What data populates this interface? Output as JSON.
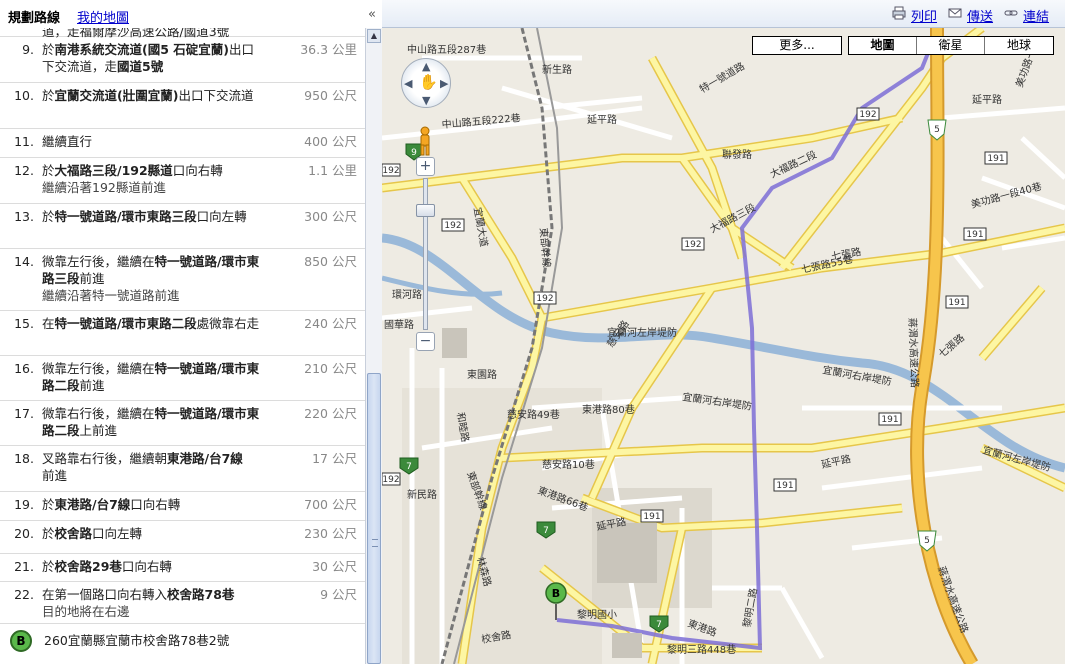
{
  "panel": {
    "title": "規劃路線",
    "my_maps_link": "我的地圖",
    "collapse": "«"
  },
  "steps": [
    {
      "num": "",
      "text": "道，走福爾摩沙高速公路/國道3號",
      "dist": ""
    },
    {
      "num": "9.",
      "pre": "於",
      "b1": "南港系統交流道(國5 石碇宜蘭)",
      "post": "出口下交流道，走",
      "b2": "國道5號",
      "dist": "36.3 公里"
    },
    {
      "num": "10.",
      "pre": "於",
      "b1": "宜蘭交流道(壯圍宜蘭)",
      "post": "出口下交流道",
      "b2": "",
      "dist": "950 公尺"
    },
    {
      "num": "11.",
      "text": "繼續直行",
      "dist": "400 公尺"
    },
    {
      "num": "12.",
      "pre": "於",
      "b1": "大福路三段/192縣道",
      "post": "口向右轉",
      "note": "繼續沿著192縣道前進",
      "dist": "1.1 公里"
    },
    {
      "num": "13.",
      "pre": "於",
      "b1": "特一號道路/環市東路三段",
      "post": "口向左轉",
      "dist": "300 公尺"
    },
    {
      "num": "14.",
      "pre": "微靠左行後，繼續在",
      "b1": "特一號道路/環市東路三段",
      "post": "前進",
      "note": "繼續沿著特一號道路前進",
      "dist": "850 公尺"
    },
    {
      "num": "15.",
      "pre": "在",
      "b1": "特一號道路/環市東路二段",
      "post": "處微靠右走",
      "dist": "240 公尺"
    },
    {
      "num": "16.",
      "pre": "微靠左行後，繼續在",
      "b1": "特一號道路/環市東路二段",
      "post": "前進",
      "dist": "210 公尺"
    },
    {
      "num": "17.",
      "pre": "微靠右行後，繼續在",
      "b1": "特一號道路/環市東路二段",
      "post": "上前進",
      "dist": "220 公尺"
    },
    {
      "num": "18.",
      "pre": "叉路靠右行後，繼續朝",
      "b1": "東港路/台7線",
      "post": "前進",
      "dist": "17 公尺"
    },
    {
      "num": "19.",
      "pre": "於",
      "b1": "東港路/台7線",
      "post": "口向右轉",
      "dist": "700 公尺"
    },
    {
      "num": "20.",
      "pre": "於",
      "b1": "校舍路",
      "post": "口向左轉",
      "dist": "230 公尺"
    },
    {
      "num": "21.",
      "pre": "於",
      "b1": "校舍路29巷",
      "post": "口向右轉",
      "dist": "30 公尺"
    },
    {
      "num": "22.",
      "pre": "在第一個路口向右轉入",
      "b1": "校舍路78巷",
      "post": "",
      "note": "目的地將在右邊",
      "dist": "9 公尺"
    }
  ],
  "destination": {
    "marker": "B",
    "address": "260宜蘭縣宜蘭市校舍路78巷2號"
  },
  "toolbar": {
    "print": "列印",
    "send": "傳送",
    "link": "連結"
  },
  "map_controls": {
    "more": "更多...",
    "types": [
      "地圖",
      "衛星",
      "地球"
    ],
    "active_type": "地圖",
    "zoom_in": "+",
    "zoom_out": "−",
    "zoom_level": 0.19
  },
  "map_labels": {
    "roads": [
      "新生路",
      "延平路",
      "特一號道路",
      "聯發路",
      "大福路二段",
      "大福路三段",
      "七張路",
      "七張路55巷",
      "美功路一段40巷",
      "美功路一段",
      "延平路",
      "中山路五段222巷",
      "中山路五段287巷",
      "宜蘭大道",
      "東部幹線",
      "東部幹線",
      "宜蘭河左岸堤防",
      "宜蘭河右岸堤防",
      "宜蘭河右岸堤防",
      "宜蘭河左岸堤防",
      "慈安路",
      "慈安路49巷",
      "慈安路10巷",
      "東港路80巷",
      "東港路66巷",
      "延平路",
      "東港路",
      "黎明國小",
      "黎明三路448巷",
      "黎明二路",
      "校舍路",
      "林森路",
      "蔣渭水高速公路",
      "蔣渭水高速公路",
      "七張路",
      "延平路",
      "環河路",
      "新民路",
      "東園路",
      "和睦路",
      "國華路"
    ],
    "shields": [
      "192",
      "192",
      "192",
      "192",
      "192",
      "192",
      "191",
      "191",
      "191",
      "191",
      "191",
      "191",
      "5",
      "5",
      "7",
      "7",
      "7",
      "9"
    ],
    "marker": "B"
  },
  "colors": {
    "map_bg": "#eeebe3",
    "road_yellow": "#fdf6a3",
    "road_border": "#e6c64a",
    "highway": "#f7c54c",
    "highway_border": "#d59a2c",
    "river": "#9ab9d9",
    "route": "#7d6fd6",
    "link": "#0000cc"
  }
}
